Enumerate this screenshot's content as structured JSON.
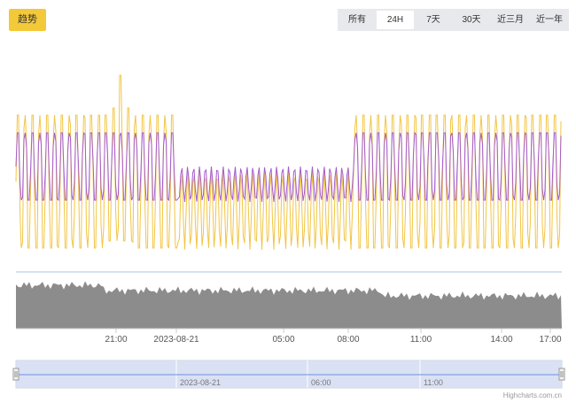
{
  "toolbar": {
    "trend_label": "趋势",
    "ranges": [
      "所有",
      "24H",
      "7天",
      "30天",
      "近三月",
      "近一年"
    ],
    "selected_range": "24H"
  },
  "colors": {
    "accent": "#f3c93a",
    "series_yellow": "#f2c544",
    "series_purple": "#a45ccf",
    "volume_fill": "#8c8c8c",
    "navigator_mask": "#d3dcf2",
    "navigator_line": "#6c8fd8"
  },
  "chart_data": {
    "type": "line",
    "title": "",
    "xlabel": "",
    "ylabel": "",
    "x_tick_labels": [
      "21:00",
      "2023-08-21",
      "05:00",
      "08:00",
      "11:00",
      "14:00",
      "17:00"
    ],
    "grid": false,
    "legend": "none"
  },
  "navigator": {
    "tick_labels": [
      "2023-08-21",
      "06:00",
      "11:00"
    ]
  },
  "credits": "Highcharts.com.cn"
}
